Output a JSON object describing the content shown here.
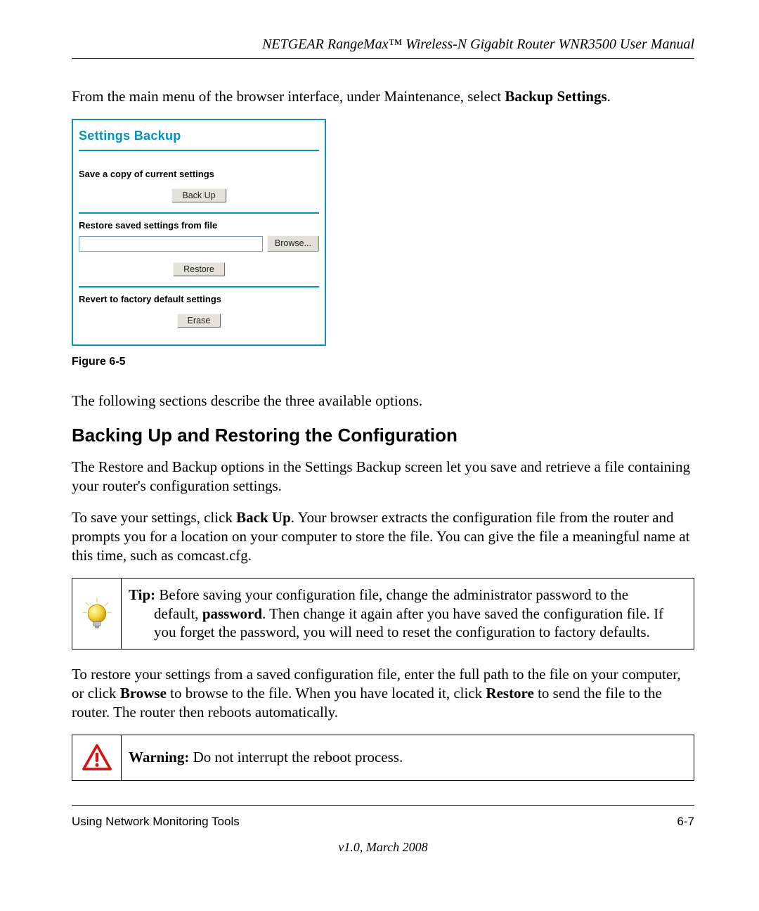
{
  "header": {
    "title": "NETGEAR RangeMax™ Wireless-N Gigabit Router WNR3500 User Manual"
  },
  "intro": {
    "prefix": "From the main menu of the browser interface, under Maintenance, select ",
    "bold": "Backup Settings",
    "suffix": "."
  },
  "screenshot": {
    "title": "Settings Backup",
    "sec1_label": "Save a copy of current settings",
    "backup_btn": "Back Up",
    "sec2_label": "Restore saved settings from file",
    "browse_btn": "Browse...",
    "restore_btn": "Restore",
    "sec3_label": "Revert to factory default settings",
    "erase_btn": "Erase"
  },
  "figure_caption": "Figure 6-5",
  "after_figure": "The following sections describe the three available options.",
  "section_heading": "Backing Up and Restoring the Configuration",
  "para1": "The Restore and Backup options in the Settings Backup screen let you save and retrieve a file containing your router's configuration settings.",
  "para2": {
    "p1": "To save your settings, click ",
    "b1": "Back Up",
    "p2": ". Your browser extracts the configuration file from the router and prompts you for a location on your computer to store the file. You can give the file a meaningful name at this time, such as comcast.cfg."
  },
  "tip": {
    "label": "Tip:",
    "l1a": " Before saving your configuration file, change the administrator password to the",
    "l2a": "default, ",
    "l2b": "password",
    "l2c": ". Then change it again after you have saved the configuration file. If you forget the password, you will need to reset the configuration to factory defaults."
  },
  "para3": {
    "p1": "To restore your settings from a saved configuration file, enter the full path to the file on your computer, or click ",
    "b1": "Browse",
    "p2": " to browse to the file. When you have located it, click ",
    "b2": "Restore",
    "p3": " to send the file to the router. The router then reboots automatically."
  },
  "warning": {
    "label": "Warning:",
    "text": " Do not interrupt the reboot process."
  },
  "footer": {
    "left": "Using Network Monitoring Tools",
    "right": "6-7",
    "version": "v1.0, March 2008"
  }
}
